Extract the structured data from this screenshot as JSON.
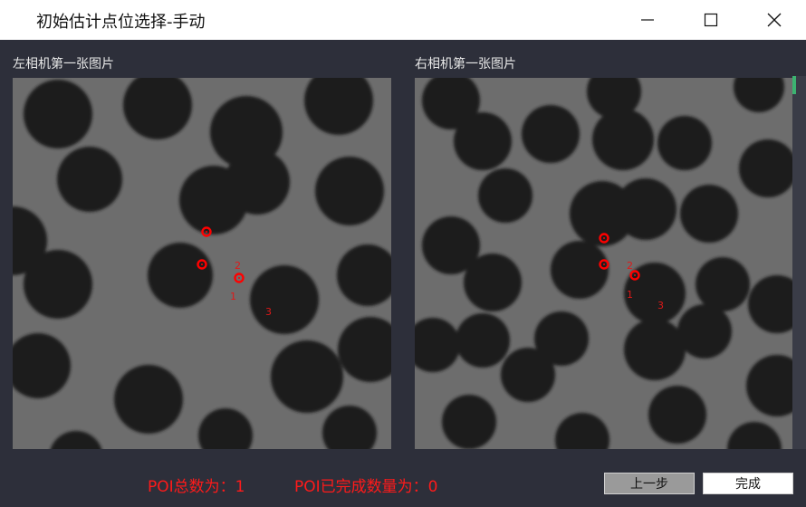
{
  "window": {
    "title": "初始估计点位选择-手动",
    "controls": [
      "minimize-icon",
      "maximize-icon",
      "close-icon"
    ]
  },
  "left_panel": {
    "label": "左相机第一张图片",
    "markers": [
      "1",
      "2",
      "3"
    ]
  },
  "right_panel": {
    "label": "右相机第一张图片",
    "markers": [
      "1",
      "2",
      "3"
    ]
  },
  "status": {
    "poi_total": "POI总数为：1",
    "poi_done": "POI已完成数量为：0"
  },
  "buttons": {
    "prev": "上一步",
    "done": "完成"
  },
  "colors": {
    "background": "#2d2f3a",
    "marker": "#ff0000",
    "status_text": "#ff1a1a",
    "titlebar": "#ffffff"
  }
}
